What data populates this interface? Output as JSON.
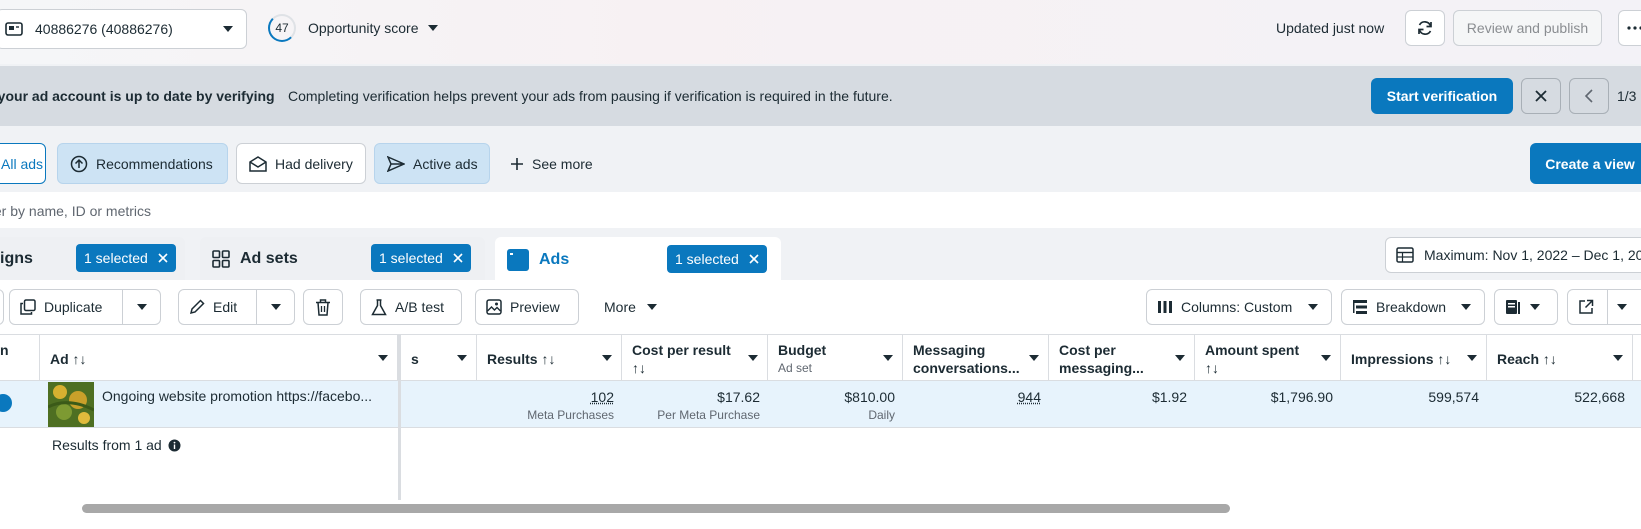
{
  "header": {
    "account_label": "40886276 (40886276)",
    "score_value": "47",
    "score_label": "Opportunity score",
    "updated_text": "Updated just now",
    "review_publish": "Review and publish"
  },
  "banner": {
    "title": "e your ad account is up to date by verifying",
    "body": "Completing verification helps prevent your ads from pausing if verification is required in the future.",
    "cta": "Start verification",
    "page": "1/3"
  },
  "views": {
    "all_ads": "All ads",
    "recommendations": "Recommendations",
    "had_delivery": "Had delivery",
    "active_ads": "Active ads",
    "see_more": "See more",
    "create_view": "Create a view"
  },
  "filter": {
    "placeholder": "ter by name, ID or metrics"
  },
  "level_tabs": {
    "campaigns": "igns",
    "ad_sets": "Ad sets",
    "ads": "Ads",
    "selected": "1 selected",
    "date_range": "Maximum: Nov 1, 2022 – Dec 1, 20"
  },
  "toolbar": {
    "duplicate": "Duplicate",
    "edit": "Edit",
    "ab_test": "A/B test",
    "preview": "Preview",
    "more": "More",
    "columns": "Columns: Custom",
    "breakdown": "Breakdown"
  },
  "table": {
    "headers": {
      "campaign": "n",
      "ad": "Ad ↑↓",
      "partial": "s",
      "results": "Results ↑↓",
      "cost_per_result_1": "Cost per result",
      "cost_per_result_2": "↑↓",
      "budget": "Budget",
      "budget_sub": "Ad set",
      "messaging_1": "Messaging",
      "messaging_2": "conversations...",
      "cost_messaging_1": "Cost per",
      "cost_messaging_2": "messaging...",
      "amount_spent_1": "Amount spent",
      "amount_spent_2": "↑↓",
      "impressions": "Impressions ↑↓",
      "reach": "Reach ↑↓"
    },
    "row": {
      "ad_name": "Ongoing website promotion https://facebo...",
      "results": "102",
      "results_sub": "Meta Purchases",
      "cost_per_result": "$17.62",
      "cost_per_result_sub": "Per Meta Purchase",
      "budget": "$810.00",
      "budget_sub": "Daily",
      "messaging": "944",
      "cost_messaging": "$1.92",
      "amount_spent": "$1,796.90",
      "impressions": "599,574",
      "reach": "522,668"
    },
    "summary": "Results from 1 ad"
  },
  "colors": {
    "accent": "#0a78be",
    "selected_row": "#e7f3fc"
  }
}
